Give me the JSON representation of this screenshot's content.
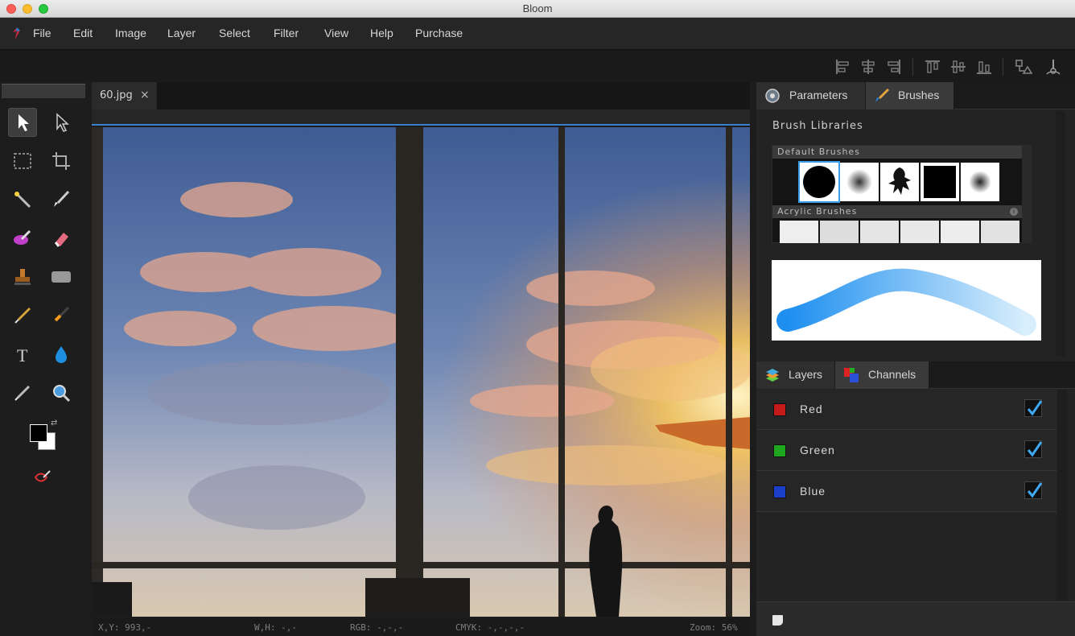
{
  "window": {
    "title": "Bloom"
  },
  "menu": {
    "items": [
      "File",
      "Edit",
      "Image",
      "Layer",
      "Select",
      "Filter",
      "View",
      "Help",
      "Purchase"
    ]
  },
  "toolbar": {
    "icons": [
      "align-left-icon",
      "align-center-icon",
      "align-right-icon",
      "align-top-icon",
      "align-middle-icon",
      "align-bottom-icon",
      "shapes-transform-icon",
      "anchor-point-icon"
    ]
  },
  "tools": {
    "items": [
      "move-tool-icon",
      "direct-select-tool-icon",
      "marquee-tool-icon",
      "crop-tool-icon",
      "magic-wand-icon",
      "brush-tool-icon",
      "smudge-tool-icon",
      "eraser-tool-icon",
      "stamp-tool-icon",
      "shape-tool-icon",
      "pen-tool-icon",
      "fill-tool-icon",
      "text-tool-icon",
      "drop-tool-icon",
      "eyedropper-tool-icon",
      "zoom-tool-icon",
      "color-swatches-icon",
      "quick-mask-icon"
    ],
    "foreground": "#000000",
    "background": "#ffffff"
  },
  "document": {
    "tab_label": "60.jpg",
    "tab_close": "×"
  },
  "status": {
    "xy": "X,Y: 993,-",
    "wh": "W,H: -,-",
    "rgb": "RGB: -,-,-",
    "cmyk": "CMYK: -,-,-,-",
    "zoom": "Zoom: 56%"
  },
  "right_top_tabs": [
    {
      "label": "Parameters"
    },
    {
      "label": "Brushes"
    }
  ],
  "brushes": {
    "title": "Brush Libraries",
    "groups": [
      {
        "name": "Default Brushes"
      },
      {
        "name": "Acrylic Brushes"
      }
    ],
    "info_icon": "info-icon"
  },
  "right_bottom_tabs": [
    {
      "label": "Layers"
    },
    {
      "label": "Channels"
    }
  ],
  "channels": [
    {
      "name": "Red",
      "color": "#d11a1a",
      "checked": true
    },
    {
      "name": "Green",
      "color": "#1fa81f",
      "checked": true
    },
    {
      "name": "Blue",
      "color": "#1a3fd1",
      "checked": true
    }
  ],
  "colors": {
    "accent": "#3b9de8",
    "check": "#3fa9f5"
  }
}
